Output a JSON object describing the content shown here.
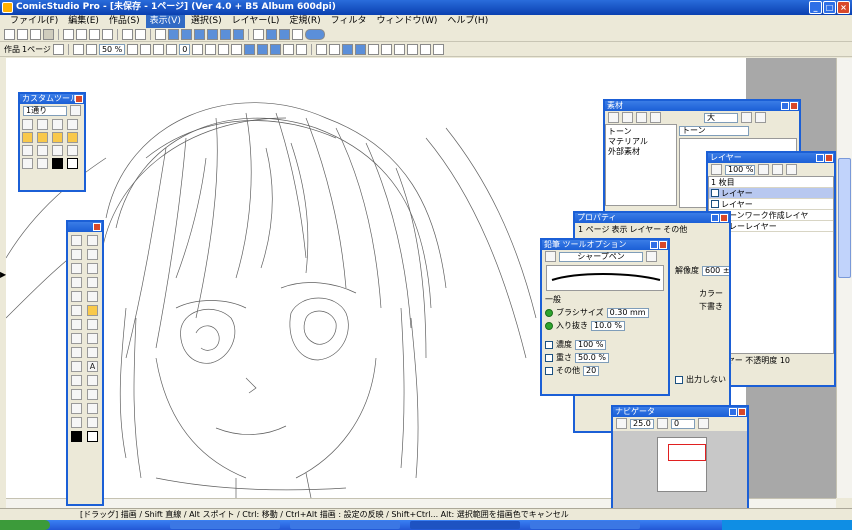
{
  "window": {
    "title": "ComicStudio Pro - [未保存 - 1ページ] (Ver 4.0 + B5 Album 600dpi)",
    "minimize": "_",
    "maximize": "□",
    "close": "×"
  },
  "menubar": {
    "items": [
      "ファイル(F)",
      "編集(E)",
      "作品(S)",
      "表示(V)",
      "選択(S)",
      "レイヤー(L)",
      "定規(R)",
      "フィルタ",
      "ウィンドウ(W)",
      "ヘルプ(H)"
    ],
    "active_index": 3
  },
  "toolbar2": {
    "tab_label": "作品",
    "page_label": "1ページ",
    "zoom": "50 %",
    "rotation": "0"
  },
  "custom_tool_panel": {
    "title": "カスタムツール",
    "preset": "1通り",
    "color_fg": "#000000",
    "color_bg": "#ffffff"
  },
  "tools_panel": {
    "title": "ツール",
    "text_tool": "A"
  },
  "materials_panel": {
    "title": "素材",
    "view_mode": "大",
    "tree": [
      "トーン",
      "マテリアル",
      "外部素材"
    ],
    "selected": "トーン"
  },
  "layer_panel": {
    "title": "レイヤー",
    "opacity": "100 %",
    "folder": "1 枚目",
    "layers": [
      "レイヤー",
      "レイヤー",
      "トーンワーク作成レイヤ",
      "グレーレイヤー"
    ],
    "footer": "レイヤー 不透明度 10"
  },
  "property_panel": {
    "title": "プロパティ",
    "tabs": [
      "1 ページ",
      "表示",
      "レイヤー",
      "その他"
    ],
    "resolution_label": "解像度",
    "resolution": "600 ±",
    "color_label": "カラー",
    "draft_label": "下書き",
    "output_label": "出力しない"
  },
  "tool_option_panel": {
    "title": "鉛筆 ツールオプション",
    "preset": "シャープペン",
    "section": "一般",
    "brush_size_label": "ブラシサイズ",
    "brush_size": "0.30 mm",
    "min_label": "入り抜き",
    "min_value": "10.0 %",
    "density_label": "濃度",
    "density": "100 %",
    "weight_label": "重さ",
    "weight": "50.0 %",
    "other_label": "その他",
    "other": "20"
  },
  "navigator_panel": {
    "title": "ナビゲータ",
    "zoom": "25.0",
    "angle": "0"
  },
  "statusbar": {
    "text": "[ドラッグ] 描画 / Shift 直線 / Alt スポイト / Ctrl: 移動 / Ctrl+Alt 描画 : 設定の反映 / Shift+Ctrl...  Alt: 選択範囲を描画色でキャンセル"
  }
}
